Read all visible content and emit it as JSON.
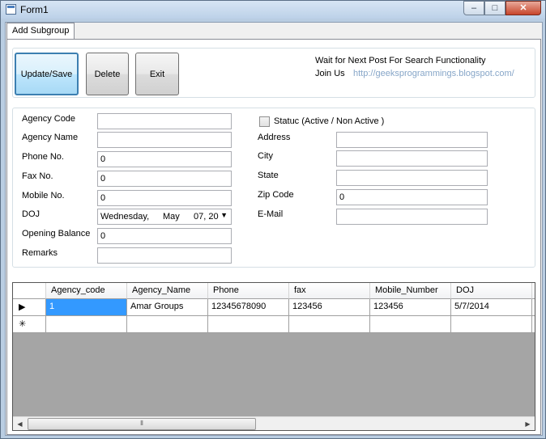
{
  "window": {
    "title": "Form1",
    "controls": {
      "minimize": "–",
      "maximize": "□",
      "close": "✕"
    }
  },
  "tabs": [
    {
      "label": "Add Subgroup"
    }
  ],
  "toolbar": {
    "update_label": "Update/Save",
    "delete_label": "Delete",
    "exit_label": "Exit",
    "note": "Wait for Next Post For Search Functionality",
    "join_label": "Join Us",
    "link_text": "http://geeksprogrammings.blogspot.com/"
  },
  "form": {
    "agency_code": {
      "label": "Agency Code",
      "value": ""
    },
    "agency_name": {
      "label": "Agency Name",
      "value": ""
    },
    "phone": {
      "label": "Phone No.",
      "value": "0"
    },
    "fax": {
      "label": "Fax No.",
      "value": "0"
    },
    "mobile": {
      "label": "Mobile No.",
      "value": "0"
    },
    "doj": {
      "label": "DOJ",
      "day": "Wednesday,",
      "month": "May",
      "date": "07, 20"
    },
    "opening_balance": {
      "label": "Opening Balance",
      "value": "0"
    },
    "remarks": {
      "label": "Remarks",
      "value": ""
    },
    "status": {
      "label": "Statuc (Active / Non Active )",
      "checked": false
    },
    "address": {
      "label": "Address",
      "value": ""
    },
    "city": {
      "label": "City",
      "value": ""
    },
    "state": {
      "label": "State",
      "value": ""
    },
    "zip": {
      "label": "Zip Code",
      "value": "0"
    },
    "email": {
      "label": "E-Mail",
      "value": ""
    }
  },
  "grid": {
    "columns": [
      "Agency_code",
      "Agency_Name",
      "Phone",
      "fax",
      "Mobile_Number",
      "DOJ"
    ],
    "rows": [
      {
        "indicator": "▶",
        "cells": [
          "1",
          "Amar Groups",
          "12345678090",
          "123456",
          "123456",
          "5/7/2014"
        ]
      },
      {
        "indicator": "✳",
        "cells": [
          "",
          "",
          "",
          "",
          "",
          ""
        ]
      }
    ],
    "scroll": {
      "left": "◀",
      "right": "▶",
      "thumb": "⦀"
    }
  },
  "colors": {
    "selection": "#3399ff",
    "grid_background": "#a5a5a5",
    "link": "#87a6c8",
    "default_button_border": "#3c7fb1"
  }
}
